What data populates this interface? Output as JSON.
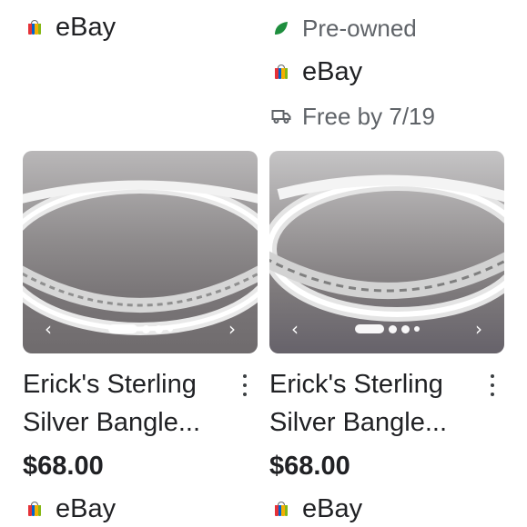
{
  "top_left": {
    "seller": "eBay",
    "seller_icon": "ebay-bag-icon"
  },
  "top_right": {
    "condition": "Pre-owned",
    "condition_icon": "leaf-icon",
    "seller": "eBay",
    "seller_icon": "ebay-bag-icon",
    "shipping": "Free by 7/19",
    "shipping_icon": "truck-icon"
  },
  "products": [
    {
      "title_line1": "Erick's Sterling",
      "title_line2": "Silver Bangle...",
      "price": "$68.00",
      "seller": "eBay",
      "image_prev": "‹",
      "image_next": "›"
    },
    {
      "title_line1": "Erick's Sterling",
      "title_line2": "Silver Bangle...",
      "price": "$68.00",
      "seller": "eBay",
      "image_prev": "‹",
      "image_next": "›"
    }
  ],
  "colors": {
    "leaf": "#1e8e3e",
    "bag_red": "#e53238",
    "bag_blue": "#0064d2",
    "bag_yellow": "#f5af02",
    "bag_green": "#86b817"
  }
}
